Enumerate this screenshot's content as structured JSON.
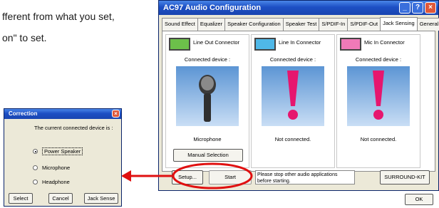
{
  "doc": {
    "line1": "fferent from what you set,",
    "line2": "on\" to set."
  },
  "window": {
    "title": "AC97 Audio Configuration",
    "tabs": [
      "Sound Effect",
      "Equalizer",
      "Speaker Configuration",
      "Speaker Test",
      "S/PDIF-In",
      "S/PDIF-Out",
      "Jack Sensing",
      "General"
    ],
    "active_tab": "Jack Sensing",
    "columns": [
      {
        "label": "Line Out Connector",
        "connected": "Connected device :",
        "status": "Microphone",
        "color": "#6cc04a"
      },
      {
        "label": "Line In Connector",
        "connected": "Connected device :",
        "status": "Not connected.",
        "color": "#4fb8e8"
      },
      {
        "label": "Mic In Connector",
        "connected": "Connected device :",
        "status": "Not connected.",
        "color": "#f07ab8"
      }
    ],
    "manual_selection": "Manual Selection",
    "setup": "Setup...",
    "start": "Start",
    "note": "Please stop other audio applications before starting.",
    "surround": "SURROUND-KIT",
    "ok": "OK"
  },
  "dialog": {
    "title": "Correction",
    "text": "The current connected device is :",
    "options": [
      {
        "label": "Power Speaker",
        "selected": true
      },
      {
        "label": "Microphone",
        "selected": false
      },
      {
        "label": "Headphone",
        "selected": false
      }
    ],
    "buttons": [
      "Select",
      "Cancel",
      "Jack Sense"
    ]
  }
}
